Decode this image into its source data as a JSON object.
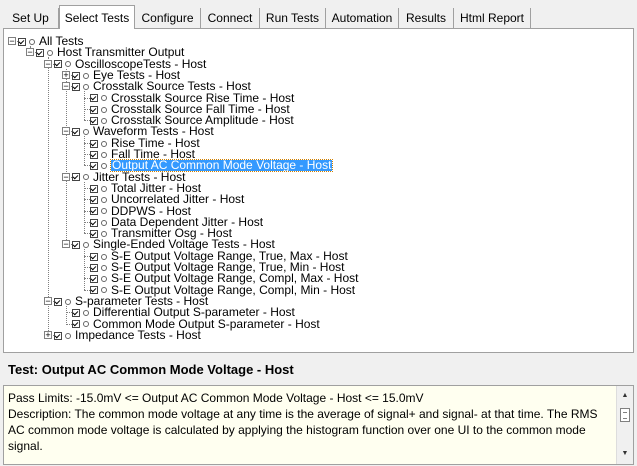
{
  "tabs": [
    "Set Up",
    "Select Tests",
    "Configure",
    "Connect",
    "Run Tests",
    "Automation",
    "Results",
    "Html Report"
  ],
  "active_tab": "Select Tests",
  "tree": {
    "nodes": [
      {
        "label": "All Tests",
        "depth": 0,
        "checked": true,
        "expander": "minus"
      },
      {
        "label": "Host Transmitter Output",
        "depth": 1,
        "checked": true,
        "expander": "minus"
      },
      {
        "label": "OscilloscopeTests - Host",
        "depth": 2,
        "checked": true,
        "expander": "minus"
      },
      {
        "label": "Eye Tests - Host",
        "depth": 3,
        "checked": true,
        "expander": "plus"
      },
      {
        "label": "Crosstalk Source Tests - Host",
        "depth": 3,
        "checked": true,
        "expander": "minus"
      },
      {
        "label": "Crosstalk Source Rise Time - Host",
        "depth": 4,
        "checked": true
      },
      {
        "label": "Crosstalk Source Fall Time - Host",
        "depth": 4,
        "checked": true
      },
      {
        "label": "Crosstalk Source Amplitude - Host",
        "depth": 4,
        "checked": true
      },
      {
        "label": "Waveform Tests - Host",
        "depth": 3,
        "checked": true,
        "expander": "minus"
      },
      {
        "label": "Rise Time - Host",
        "depth": 4,
        "checked": true
      },
      {
        "label": "Fall Time - Host",
        "depth": 4,
        "checked": true
      },
      {
        "label": "Output AC Common Mode Voltage - Host",
        "depth": 4,
        "checked": true,
        "selected": true
      },
      {
        "label": "Jitter Tests - Host",
        "depth": 3,
        "checked": true,
        "expander": "minus"
      },
      {
        "label": "Total Jitter - Host",
        "depth": 4,
        "checked": true
      },
      {
        "label": "Uncorrelated Jitter - Host",
        "depth": 4,
        "checked": true
      },
      {
        "label": "DDPWS - Host",
        "depth": 4,
        "checked": true
      },
      {
        "label": "Data Dependent Jitter - Host",
        "depth": 4,
        "checked": true
      },
      {
        "label": "Transmitter Osg - Host",
        "depth": 4,
        "checked": true
      },
      {
        "label": "Single-Ended Voltage Tests - Host",
        "depth": 3,
        "checked": true,
        "expander": "minus"
      },
      {
        "label": "S-E Output Voltage Range, True, Max - Host",
        "depth": 4,
        "checked": true
      },
      {
        "label": "S-E Output Voltage Range, True, Min - Host",
        "depth": 4,
        "checked": true
      },
      {
        "label": "S-E Output Voltage Range, Compl, Max - Host",
        "depth": 4,
        "checked": true
      },
      {
        "label": "S-E Output Voltage Range, Compl, Min - Host",
        "depth": 4,
        "checked": true
      },
      {
        "label": "S-parameter Tests - Host",
        "depth": 2,
        "checked": true,
        "expander": "minus"
      },
      {
        "label": "Differential Output S-parameter - Host",
        "depth": 3,
        "checked": true
      },
      {
        "label": "Common Mode Output S-parameter - Host",
        "depth": 3,
        "checked": true
      },
      {
        "label": "Impedance Tests - Host",
        "depth": 2,
        "checked": true,
        "expander": "plus"
      }
    ]
  },
  "detail": {
    "title": "Test: Output AC Common Mode Voltage - Host",
    "pass_limits": "Pass Limits: -15.0mV <= Output AC Common Mode Voltage - Host <= 15.0mV",
    "description": "Description: The common mode voltage at any time is the average of signal+ and signal- at that time. The RMS AC common mode voltage is calculated by applying the histogram function over one UI to the common mode signal."
  },
  "colors": {
    "selection": "#3399ff",
    "detail_background": "#fffff0",
    "window_background": "#f0f0f0"
  }
}
